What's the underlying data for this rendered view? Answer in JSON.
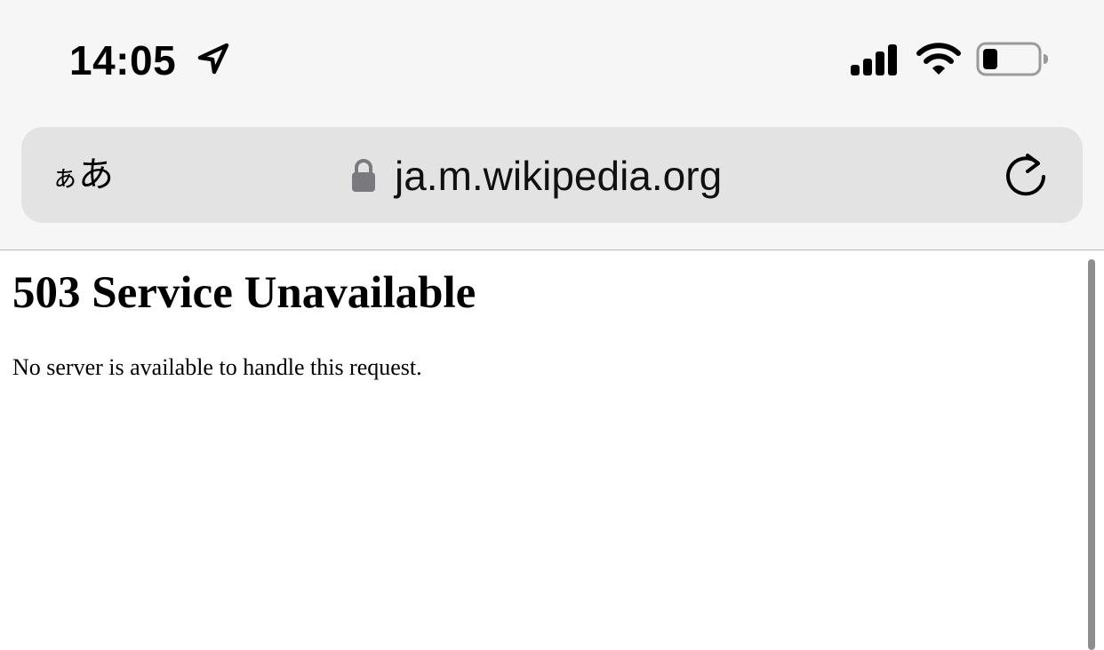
{
  "status_bar": {
    "time": "14:05",
    "icons": {
      "location": "location-arrow-icon",
      "signal": "cellular-signal-icon",
      "wifi": "wifi-icon",
      "battery": "battery-low-icon"
    }
  },
  "browser": {
    "text_size_label_small": "ぁ",
    "text_size_label_large": "あ",
    "url": "ja.m.wikipedia.org",
    "secure_icon": "lock-icon",
    "reload_icon": "reload-icon"
  },
  "page": {
    "title": "503 Service Unavailable",
    "message": "No server is available to handle this request."
  }
}
